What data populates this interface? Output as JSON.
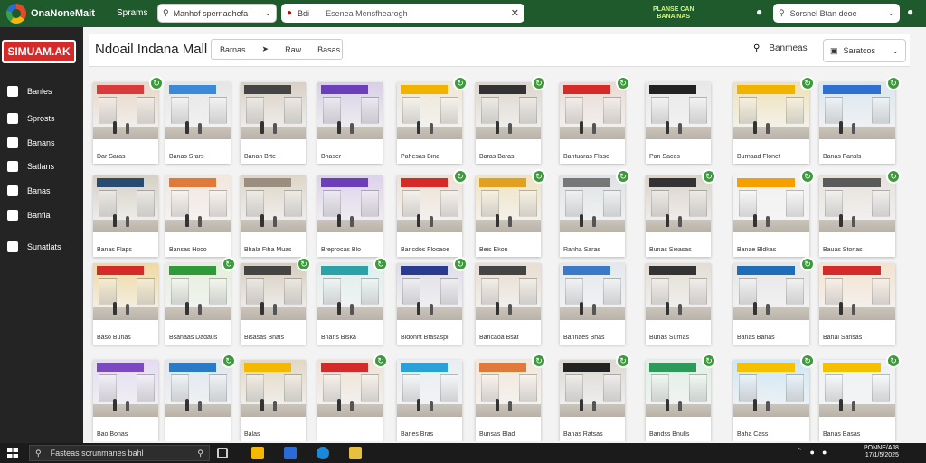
{
  "topbar": {
    "app_name": "OnaNoneMait",
    "menu_label": "Sprams",
    "search_text": "Manhof spernadhefa",
    "url_prefix": "Bdi",
    "url_text": "Esenea Mensfhearogh",
    "status_line1": "PLANSE CAN",
    "status_line2": "BANA NAS",
    "right_search_text": "Sorsnel Btan deoe"
  },
  "sidebar": {
    "brand": "SIMUAM.AK",
    "items": [
      {
        "label": "Banles",
        "icon": "home-icon"
      },
      {
        "label": "Sprosts",
        "icon": "sports-icon"
      },
      {
        "label": "Banans",
        "icon": "bag-icon"
      },
      {
        "label": "Satlans",
        "icon": "store-icon"
      },
      {
        "label": "Banas",
        "icon": "building-icon"
      },
      {
        "label": "Banfla",
        "icon": "folder-icon"
      },
      {
        "label": "Sunatlats",
        "icon": "settings-icon"
      }
    ]
  },
  "header": {
    "title": "Ndoail Indana Mall",
    "tabs": [
      "Barnas",
      "Raw",
      "Basas"
    ],
    "right_label": "Banmeas",
    "filter_label": "Saratcos"
  },
  "grid": {
    "cards": [
      {
        "caption": "Dar Saras",
        "badge": true,
        "sign": "#d73b3b",
        "wall": "#e8d7c8"
      },
      {
        "caption": "Banas Srars",
        "badge": false,
        "sign": "#3a8ad8",
        "wall": "#e6e6e6"
      },
      {
        "caption": "Banan Brte",
        "badge": false,
        "sign": "#444",
        "wall": "#d9d0c4"
      },
      {
        "caption": "Bhaser",
        "badge": false,
        "sign": "#6b3fb8",
        "wall": "#d7d0e5"
      },
      {
        "caption": "Pahesas Bina",
        "badge": true,
        "sign": "#f0b400",
        "wall": "#efe7d7"
      },
      {
        "caption": "Baras Baras",
        "badge": true,
        "sign": "#333",
        "wall": "#ddd6cc"
      },
      {
        "caption": "Bantuaras Flaso",
        "badge": true,
        "sign": "#d42a2a",
        "wall": "#eadbd3"
      },
      {
        "caption": "Pan Saces",
        "badge": false,
        "sign": "#222",
        "wall": "#e8e8e8"
      },
      {
        "caption": "Burnaad Flonet",
        "badge": true,
        "sign": "#f0b400",
        "wall": "#efe2b8"
      },
      {
        "caption": "Banas Fansls",
        "badge": true,
        "sign": "#2f6fd0",
        "wall": "#dbe6ee"
      },
      {
        "caption": "Banas Flaps",
        "badge": false,
        "sign": "#2a4a70",
        "wall": "#d6d0c6"
      },
      {
        "caption": "Bansas Hoco",
        "badge": false,
        "sign": "#e07a3a",
        "wall": "#f2e7df"
      },
      {
        "caption": "Bhala Fiha Muas",
        "badge": false,
        "sign": "#9a8e7e",
        "wall": "#ddd6c8"
      },
      {
        "caption": "Breprocas Blo",
        "badge": false,
        "sign": "#6c3fb8",
        "wall": "#dcd2e9"
      },
      {
        "caption": "Bancdos Flocaoe",
        "badge": true,
        "sign": "#d42a2a",
        "wall": "#ece2d4"
      },
      {
        "caption": "Beis Ekon",
        "badge": true,
        "sign": "#e0a020",
        "wall": "#efe3c2"
      },
      {
        "caption": "Ranha Saras",
        "badge": true,
        "sign": "#777",
        "wall": "#dfe3e6"
      },
      {
        "caption": "Bunac Sieasas",
        "badge": true,
        "sign": "#333",
        "wall": "#d9d3c9"
      },
      {
        "caption": "Banae Bldkas",
        "badge": true,
        "sign": "#f5a000",
        "wall": "#f2f2f2"
      },
      {
        "caption": "Bauas Stonas",
        "badge": true,
        "sign": "#5a5a5a",
        "wall": "#e6e1db"
      },
      {
        "caption": "Baso Bunas",
        "badge": false,
        "sign": "#d42a2a",
        "wall": "#f0d9a0"
      },
      {
        "caption": "Bsanaas Dadaus",
        "badge": true,
        "sign": "#2e9a3a",
        "wall": "#e5efdc"
      },
      {
        "caption": "Bisasas Bnais",
        "badge": true,
        "sign": "#444",
        "wall": "#d7cdbf"
      },
      {
        "caption": "Bnans Biska",
        "badge": true,
        "sign": "#2aa2a8",
        "wall": "#e0eeee"
      },
      {
        "caption": "Bidonnt Bfasaspi",
        "badge": true,
        "sign": "#2a3a90",
        "wall": "#e0dde8"
      },
      {
        "caption": "Bancaoa Bsat",
        "badge": false,
        "sign": "#444",
        "wall": "#e8ddd0"
      },
      {
        "caption": "Bannaes Bhas",
        "badge": false,
        "sign": "#3b79c8",
        "wall": "#e4e8ee"
      },
      {
        "caption": "Bunas Surnas",
        "badge": false,
        "sign": "#333",
        "wall": "#e3ddd3"
      },
      {
        "caption": "Banas Banas",
        "badge": true,
        "sign": "#1d6db8",
        "wall": "#e6e6e6"
      },
      {
        "caption": "Banal Sansas",
        "badge": false,
        "sign": "#d42a2a",
        "wall": "#f3e2cf"
      },
      {
        "caption": "Bao Bonas",
        "badge": false,
        "sign": "#7a4ac0",
        "wall": "#e4dcf0"
      },
      {
        "caption": "",
        "badge": true,
        "sign": "#2a7ac8",
        "wall": "#dfe6ee"
      },
      {
        "caption": "Balas",
        "badge": false,
        "sign": "#f5b800",
        "wall": "#e2d7c3"
      },
      {
        "caption": "",
        "badge": true,
        "sign": "#d42a2a",
        "wall": "#efe2d4"
      },
      {
        "caption": "Banes Bras",
        "badge": false,
        "sign": "#2aa2d8",
        "wall": "#e9eef3"
      },
      {
        "caption": "Bunsas Blad",
        "badge": true,
        "sign": "#e07a3a",
        "wall": "#f3e7da"
      },
      {
        "caption": "Banas Ratsas",
        "badge": true,
        "sign": "#222",
        "wall": "#dcd8d2"
      },
      {
        "caption": "Bandss Bnulls",
        "badge": true,
        "sign": "#2e9a5a",
        "wall": "#e1efe6"
      },
      {
        "caption": "Baha Cass",
        "badge": true,
        "sign": "#f5c000",
        "wall": "#cfe6f5"
      },
      {
        "caption": "Banas Basas",
        "badge": true,
        "sign": "#f5c000",
        "wall": "#eef2f5"
      }
    ]
  },
  "taskbar": {
    "search_text": "Fasteas scrunmanes bahl",
    "clock_line1": "PONNE/AJ8",
    "clock_line2": "17/1/5/2025"
  }
}
